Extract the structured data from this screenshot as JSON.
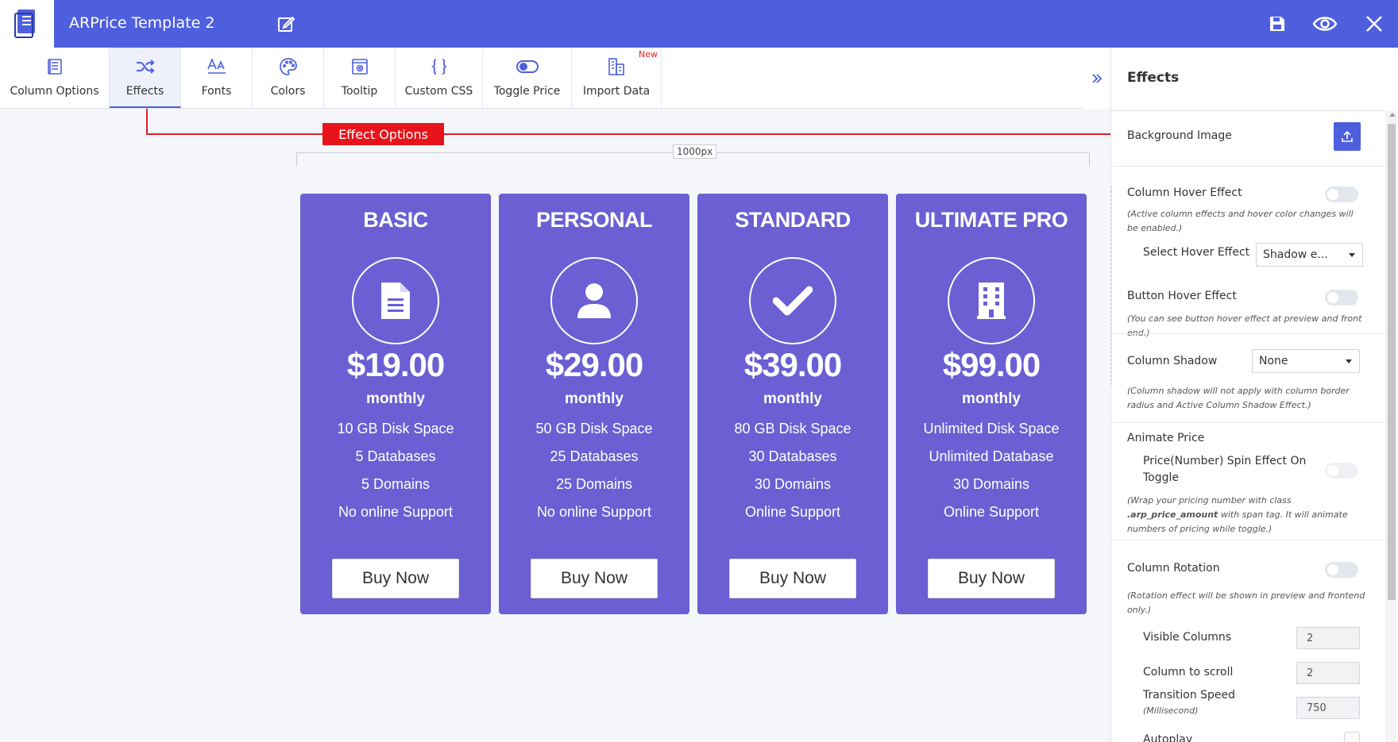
{
  "header": {
    "title": "ARPrice Template 2",
    "actions": [
      "save-icon",
      "preview-eye-icon",
      "close-icon"
    ],
    "bg_color": "#4e5fde"
  },
  "toolbar": {
    "tools": [
      {
        "label": "Column Options",
        "icon": "column-options-icon"
      },
      {
        "label": "Effects",
        "icon": "shuffle-icon",
        "active": true
      },
      {
        "label": "Fonts",
        "icon": "font-icon"
      },
      {
        "label": "Colors",
        "icon": "palette-icon"
      },
      {
        "label": "Tooltip",
        "icon": "tooltip-icon"
      },
      {
        "label": "Custom CSS",
        "icon": "braces-icon"
      },
      {
        "label": "Toggle Price",
        "icon": "toggle-icon"
      },
      {
        "label": "Import Data",
        "icon": "import-data-icon",
        "badge": "New"
      }
    ]
  },
  "annotation": {
    "label": "Effect Options",
    "color": "#e8141c"
  },
  "canvas": {
    "width_label": "1000px"
  },
  "cards": [
    {
      "name": "BASIC",
      "icon": "document-icon",
      "price": "$19.00",
      "period": "monthly",
      "features": [
        "10 GB Disk Space",
        "5 Databases",
        "5 Domains",
        "No online Support"
      ],
      "button": "Buy Now"
    },
    {
      "name": "PERSONAL",
      "icon": "user-icon",
      "price": "$29.00",
      "period": "monthly",
      "features": [
        "50 GB Disk Space",
        "25 Databases",
        "25 Domains",
        "No online Support"
      ],
      "button": "Buy Now"
    },
    {
      "name": "STANDARD",
      "icon": "checkmark-icon",
      "price": "$39.00",
      "period": "monthly",
      "features": [
        "80 GB Disk Space",
        "30 Databases",
        "30 Domains",
        "Online Support"
      ],
      "button": "Buy Now"
    },
    {
      "name": "ULTIMATE PRO",
      "icon": "building-icon",
      "price": "$99.00",
      "period": "monthly",
      "features": [
        "Unlimited Disk Space",
        "Unlimited Database",
        "30 Domains",
        "Online Support"
      ],
      "button": "Buy Now"
    }
  ],
  "card_color": "#6b5fd3",
  "panel": {
    "title": "Effects",
    "background_image": {
      "label": "Background Image"
    },
    "column_hover": {
      "label": "Column Hover Effect",
      "note": "(Active column effects and hover color changes will be enabled.)",
      "select_label": "Select Hover Effect",
      "select_value": "Shadow e..."
    },
    "button_hover": {
      "label": "Button Hover Effect",
      "note": "(You can see button hover effect at preview and front end.)"
    },
    "column_shadow": {
      "label": "Column Shadow",
      "value": "None",
      "note": "(Column shadow will not apply with column border radius and Active Column Shadow Effect.)"
    },
    "animate_price": {
      "label": "Animate Price",
      "sub_label": "Price(Number) Spin Effect On Toggle",
      "note_pre": "(Wrap your pricing number with class ",
      "note_code": ".arp_price_amount",
      "note_post": " with span tag. It will animate numbers of pricing while toggle.)"
    },
    "column_rotation": {
      "label": "Column Rotation",
      "note": "(Rotation effect will be shown in preview and frontend only.)",
      "visible_columns_label": "Visible Columns",
      "visible_columns": "2",
      "column_to_scroll_label": "Column to scroll",
      "column_to_scroll": "2",
      "transition_speed_label": "Transition Speed",
      "transition_speed_unit": "(Millisecond)",
      "transition_speed": "750",
      "autoplay_label": "Autoplay"
    }
  }
}
